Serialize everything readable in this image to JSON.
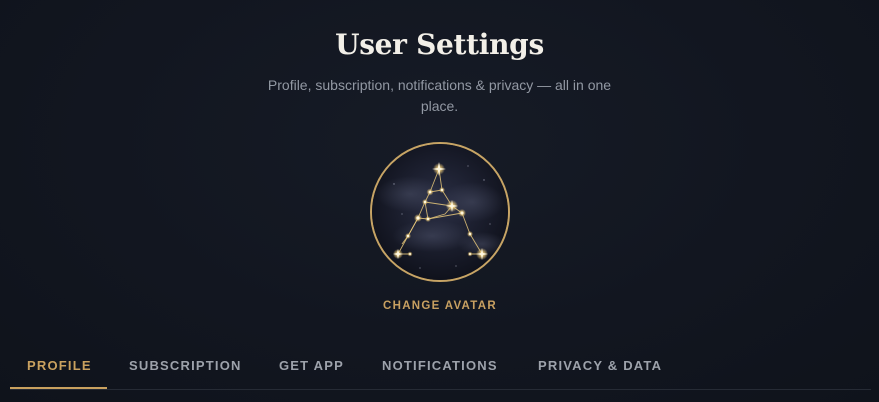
{
  "header": {
    "title": "User Settings",
    "subtitle": "Profile, subscription, notifications & privacy — all in one place."
  },
  "avatar": {
    "icon": "constellation-letter-a-icon",
    "change_label": "CHANGE AVATAR"
  },
  "tabs": [
    {
      "label": "PROFILE",
      "active": true
    },
    {
      "label": "SUBSCRIPTION",
      "active": false
    },
    {
      "label": "GET APP",
      "active": false
    },
    {
      "label": "NOTIFICATIONS",
      "active": false
    },
    {
      "label": "PRIVACY & DATA",
      "active": false
    }
  ],
  "colors": {
    "background": "#121620",
    "accent_gold": "#c9a15f",
    "title": "#f2efe8",
    "muted_text": "#9298a3",
    "tab_inactive": "#9da2ab"
  }
}
